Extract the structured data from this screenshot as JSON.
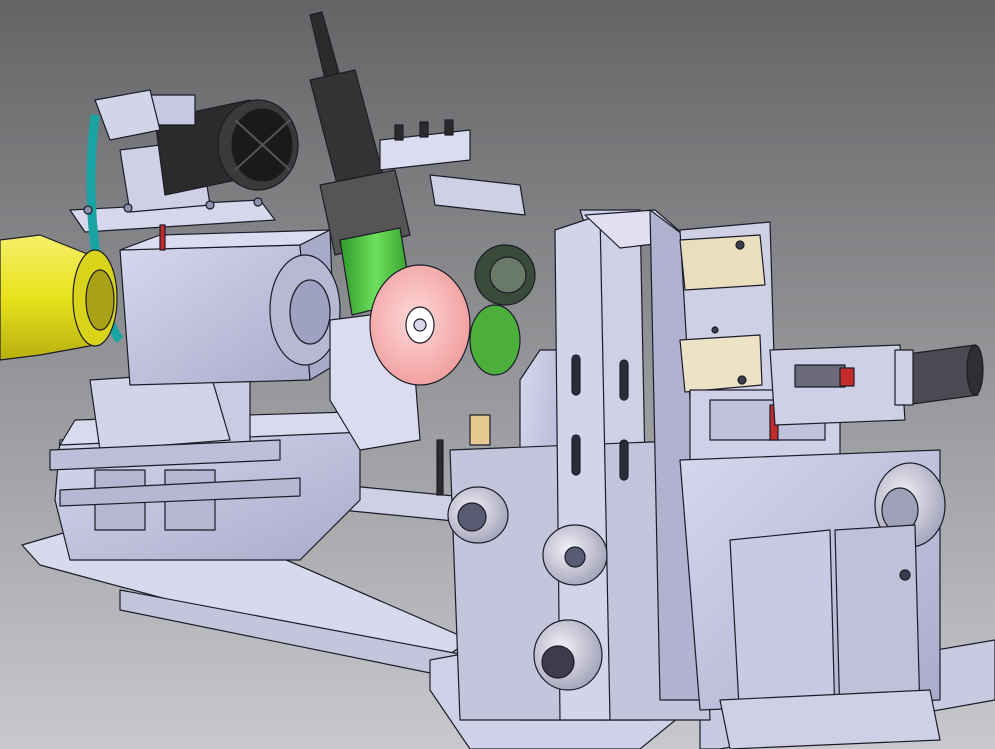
{
  "scene": {
    "background_top": "#636466",
    "background_bottom": "#c7c9cc",
    "metal_fill": "#bfc0dc",
    "metal_dark": "#8e90b0",
    "metal_light": "#dcdcf0",
    "edge_color": "#1c1c28",
    "yellow_part": "#e8e21c",
    "green_part": "#44c23a",
    "teal_belt": "#1aa3a3",
    "motor_black": "#2b2b2b",
    "wheel_pink": "#f4a9a9",
    "red_accent": "#c62b2b"
  }
}
